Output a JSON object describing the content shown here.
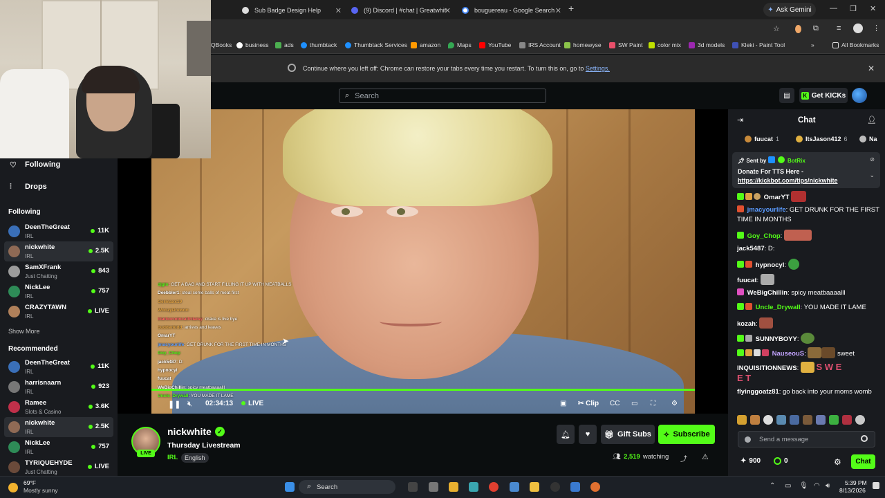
{
  "browser": {
    "tabs": [
      {
        "label": "Sub Badge Design Help"
      },
      {
        "label": "(9) Discord | #chat | Greatwhite"
      },
      {
        "label": "bouguereau - Google Search"
      }
    ],
    "new_tab": "+",
    "ask_gemini": "Ask Gemini",
    "bookmarks": [
      "QBooks",
      "business",
      "ads",
      "thumbtack",
      "Thumbtack Services",
      "amazon",
      "Maps",
      "YouTube",
      "IRS Account",
      "homewyse",
      "SW Paint",
      "color mix",
      "3d models",
      "Kleki - Paint Tool"
    ],
    "all_bookmarks": "All Bookmarks",
    "restore_message": "Continue where you left off: Chrome can restore your tabs every time you restart. To turn this on, go to",
    "restore_link": "Settings."
  },
  "kick": {
    "search_placeholder": "Search",
    "get_kicks": "Get KICKs",
    "nav": [
      {
        "label": "Following"
      },
      {
        "label": "Drops"
      }
    ],
    "following_title": "Following",
    "following": [
      {
        "name": "DeenTheGreat",
        "category": "IRL",
        "viewers": "11K",
        "avatar_color": "#3a6fb8"
      },
      {
        "name": "nickwhite",
        "category": "IRL",
        "viewers": "2.5K",
        "avatar_color": "#8f6a55"
      },
      {
        "name": "SamXFrank",
        "category": "Just Chatting",
        "viewers": "843",
        "avatar_color": "#9c9c9c"
      },
      {
        "name": "NickLee",
        "category": "IRL",
        "viewers": "757",
        "avatar_color": "#2e8b57"
      },
      {
        "name": "CRAZYTAWN",
        "category": "IRL",
        "viewers": "LIVE",
        "avatar_color": "#b0805a"
      }
    ],
    "show_more": "Show More",
    "recommended_title": "Recommended",
    "recommended": [
      {
        "name": "DeenTheGreat",
        "category": "IRL",
        "viewers": "11K",
        "avatar_color": "#3a6fb8"
      },
      {
        "name": "harrisnaarn",
        "category": "IRL",
        "viewers": "923",
        "avatar_color": "#777777"
      },
      {
        "name": "Ramee",
        "category": "Slots & Casino",
        "viewers": "3.6K",
        "avatar_color": "#c0304a"
      },
      {
        "name": "nickwhite",
        "category": "IRL",
        "viewers": "2.5K",
        "avatar_color": "#8f6a55"
      },
      {
        "name": "NickLee",
        "category": "IRL",
        "viewers": "757",
        "avatar_color": "#2e8b57"
      },
      {
        "name": "TYRIQUEHYDE",
        "category": "Just Chatting",
        "viewers": "LIVE",
        "avatar_color": "#6a4a3a"
      }
    ]
  },
  "player": {
    "time": "02:34:13",
    "live": "LIVE",
    "clip": "Clip",
    "overlay_chat": [
      {
        "user": "djglo",
        "text": ": GET A BAG AND START FILLING IT UP WITH MEATBALLS"
      },
      {
        "user": "Deebbler1",
        "text": ": steal some balls of meat first"
      },
      {
        "user": "Germaxx19",
        "text": ""
      },
      {
        "user": "WoozyDrewoo",
        "text": ""
      },
      {
        "user": "blarborodocatfrdaisy",
        "text": ": drake is live bye"
      },
      {
        "user": "budderkidd",
        "text": ": arrives and leaves"
      },
      {
        "user": "OmarYT",
        "text": ""
      },
      {
        "user": "jmacyourlife",
        "text": ": GET DRUNK FOR THE FIRST TIME IN MONTHS"
      },
      {
        "user": "Goy_Chop",
        "text": ""
      },
      {
        "user": "jack5487",
        "text": ": D:"
      },
      {
        "user": "hypnocyl",
        "text": ""
      },
      {
        "user": "fuucat",
        "text": ""
      },
      {
        "user": "WeBigChillin",
        "text": ": spicy meatbaaaalll"
      },
      {
        "user": "Uncle_Drywall",
        "text": ": YOU MADE IT LAME"
      }
    ]
  },
  "stream": {
    "streamer": "nickwhite",
    "live_badge": "LIVE",
    "title": "Thursday Livestream",
    "category": "IRL",
    "language": "English",
    "gift_subs": "Gift Subs",
    "subscribe": "Subscribe",
    "viewers": "2,519",
    "watching_label": "watching"
  },
  "chat": {
    "title": "Chat",
    "leaderboard": [
      {
        "name": "fuucat",
        "count": "1",
        "badge_color": "#c88a3a"
      },
      {
        "name": "ItsJason412",
        "count": "6",
        "badge_color": "#e0b040"
      },
      {
        "name": "Na",
        "count": "",
        "badge_color": "#bbbbbb"
      }
    ],
    "pinned": {
      "sent_by_label": "Sent by",
      "sent_by_user": "BotRix",
      "text": "Donate For TTS Here -",
      "link": "https://kickbot.com/tips/nickwhite"
    },
    "messages": [
      {
        "user": "OmarYT",
        "color": "#ffffff",
        "text": ""
      },
      {
        "user": "jmacyourlife",
        "color": "#5a9bff",
        "text": ": GET DRUNK FOR THE FIRST TIME IN MONTHS"
      },
      {
        "user": "Goy_Chop",
        "color": "#53fc18",
        "text": ""
      },
      {
        "user": "jack5487",
        "color": "#ffffff",
        "text": ": D:"
      },
      {
        "user": "hypnocyl",
        "color": "#ffffff",
        "text": ""
      },
      {
        "user": "fuucat",
        "color": "#ffffff",
        "text": ""
      },
      {
        "user": "WeBigChillin",
        "color": "#ffffff",
        "text": ": spicy meatbaaaalll"
      },
      {
        "user": "Uncle_Drywall",
        "color": "#53fc18",
        "text": ": YOU MADE IT LAME"
      },
      {
        "user": "kozah",
        "color": "#ffffff",
        "text": ""
      },
      {
        "user": "SUNNYBOYY",
        "color": "#ffffff",
        "text": ""
      },
      {
        "user": "NauseouS",
        "color": "#c3a4ff",
        "text": ""
      },
      {
        "user": "INQUISITIONNEWS",
        "color": "#ffffff",
        "text": ""
      },
      {
        "user": "flyinggoatz81",
        "color": "#ffffff",
        "text": ": go back into your moms womb"
      }
    ],
    "nauseous_tail": "sweet",
    "inquisition_letters": "S W E",
    "inquisition_letters2": "E T",
    "send_placeholder": "Send a message",
    "points_a": "900",
    "points_b": "0",
    "chat_button": "Chat"
  },
  "taskbar": {
    "temp": "69°F",
    "weather": "Mostly sunny",
    "search": "Search",
    "time": "5:39 PM",
    "date": "8/13/2026"
  },
  "colors": {
    "accent": "#53fc18",
    "bg": "#0b0e0f",
    "panel": "#191b1f"
  }
}
